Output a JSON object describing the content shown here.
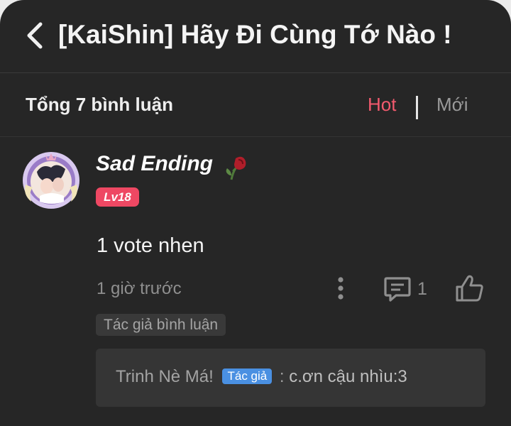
{
  "header": {
    "title": "[KaiShin] Hãy Đi Cùng Tớ Nào !"
  },
  "comments_bar": {
    "count_label": "Tổng 7 bình luận",
    "sort_hot": "Hot",
    "sort_new": "Mới",
    "active_sort_color": "#f25a6e"
  },
  "comment": {
    "username": "Sad Ending",
    "level": "Lv18",
    "content": "1 vote nhen",
    "time": "1 giờ trước",
    "reply_count": "1",
    "author_tag": "Tác giả bình luận",
    "icons": [
      "avatar",
      "wilted-rose-icon",
      "more-vertical-icon",
      "comment-reply-icon",
      "thumbs-up-icon"
    ]
  },
  "reply": {
    "name": "Trinh Nè Má!",
    "badge": "Tác giả",
    "separator": ":",
    "text": "c.ơn cậu nhìu:3",
    "badge_color": "#4a90e2"
  }
}
